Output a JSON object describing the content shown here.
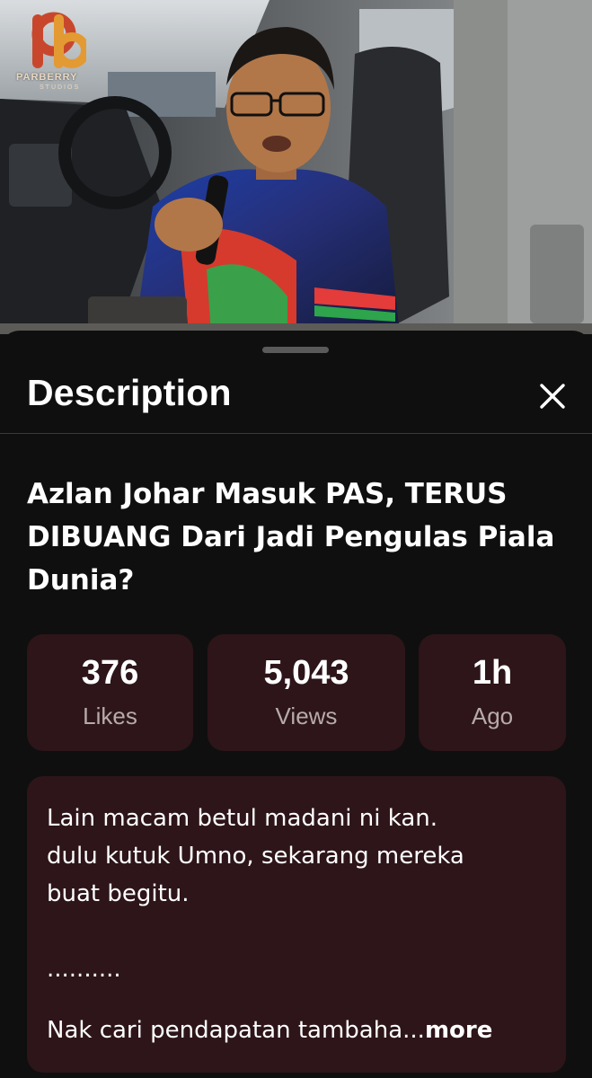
{
  "video": {
    "channel_logo": {
      "icon": "pb-logo-icon",
      "wordmark": "PARBERRY",
      "sub": "STUDIOS"
    }
  },
  "sheet": {
    "title": "Description",
    "close_icon": "close-icon"
  },
  "video_title": "Azlan Johar Masuk PAS, TERUS DIBUANG Dari Jadi Pengulas Piala Dunia?",
  "stats": [
    {
      "value": "376",
      "label": "Likes"
    },
    {
      "value": "5,043",
      "label": "Views"
    },
    {
      "value": "1h",
      "label": "Ago"
    }
  ],
  "description": {
    "text": "Lain macam betul madani ni kan.\ndulu kutuk Umno, sekarang mereka\nbuat begitu.\n\n..........",
    "last_line": "Nak cari pendapatan tambaha",
    "ellipsis": "...",
    "more_label": "more"
  },
  "colors": {
    "background": "#0f0f0f",
    "card": "#2d1519",
    "muted_text": "#b7aaab",
    "divider": "#3a3a3a"
  }
}
